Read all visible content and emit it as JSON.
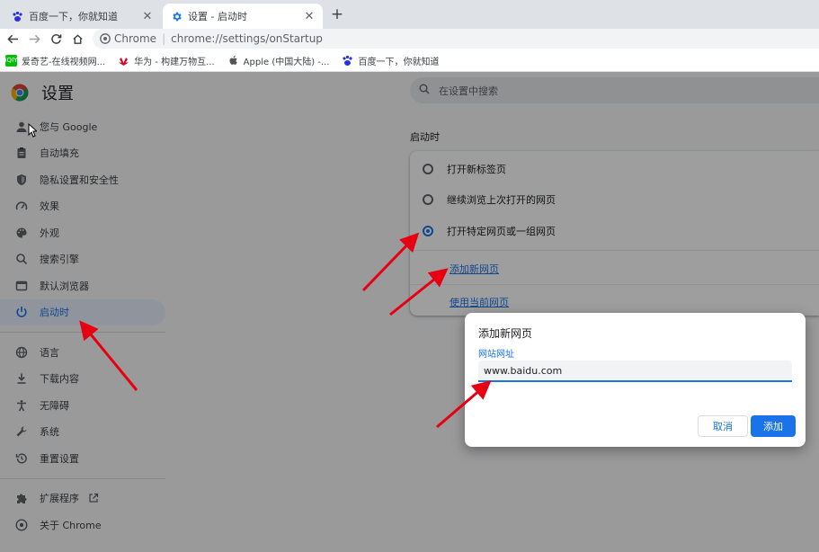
{
  "tabs": [
    {
      "title": "百度一下，你就知道",
      "icon": "baidu-paw-icon",
      "active": false
    },
    {
      "title": "设置 - 启动时",
      "icon": "settings-gear-icon",
      "active": true
    }
  ],
  "tab_close_glyph": "✕",
  "new_tab_glyph": "+",
  "omnibox": {
    "site": "Chrome",
    "separator": "|",
    "url": "chrome://settings/onStartup"
  },
  "bookmarks": [
    {
      "label": "爱奇艺-在线视频网...",
      "icon": "iqiyi-icon",
      "icon_text": "iQIY",
      "color": "#00be06"
    },
    {
      "label": "华为 - 构建万物互...",
      "icon": "huawei-icon",
      "color": "#cf0a2c"
    },
    {
      "label": "Apple (中国大陆) -...",
      "icon": "apple-icon",
      "color": "#555555"
    },
    {
      "label": "百度一下，你就知道",
      "icon": "baidu-paw-icon",
      "color": "#2932e1"
    }
  ],
  "settings": {
    "title": "设置",
    "search_placeholder": "在设置中搜索",
    "nav_group1": [
      {
        "label": "您与 Google",
        "icon": "person-icon"
      },
      {
        "label": "自动填充",
        "icon": "clipboard-icon"
      },
      {
        "label": "隐私设置和安全性",
        "icon": "shield-icon"
      },
      {
        "label": "效果",
        "icon": "speedometer-icon"
      },
      {
        "label": "外观",
        "icon": "palette-icon"
      },
      {
        "label": "搜索引擎",
        "icon": "search-icon"
      },
      {
        "label": "默认浏览器",
        "icon": "browser-window-icon"
      },
      {
        "label": "启动时",
        "icon": "power-icon",
        "active": true
      }
    ],
    "nav_group2": [
      {
        "label": "语言",
        "icon": "globe-icon"
      },
      {
        "label": "下载内容",
        "icon": "download-icon"
      },
      {
        "label": "无障碍",
        "icon": "accessibility-icon"
      },
      {
        "label": "系统",
        "icon": "wrench-icon"
      },
      {
        "label": "重置设置",
        "icon": "restore-icon"
      }
    ],
    "nav_group3": [
      {
        "label": "扩展程序",
        "icon": "puzzle-icon",
        "external": true
      },
      {
        "label": "关于 Chrome",
        "icon": "chrome-icon"
      }
    ],
    "section_title": "启动时",
    "startup_options": [
      {
        "label": "打开新标签页",
        "checked": false
      },
      {
        "label": "继续浏览上次打开的网页",
        "checked": false
      },
      {
        "label": "打开特定网页或一组网页",
        "checked": true
      }
    ],
    "add_page_link": "添加新网页",
    "use_current_link": "使用当前网页"
  },
  "dialog": {
    "title": "添加新网页",
    "field_label": "网站网址",
    "field_value": "www.baidu.com",
    "cancel_label": "取消",
    "add_label": "添加"
  },
  "colors": {
    "accent": "#1a73e8",
    "annotation_arrow": "#e60012"
  }
}
